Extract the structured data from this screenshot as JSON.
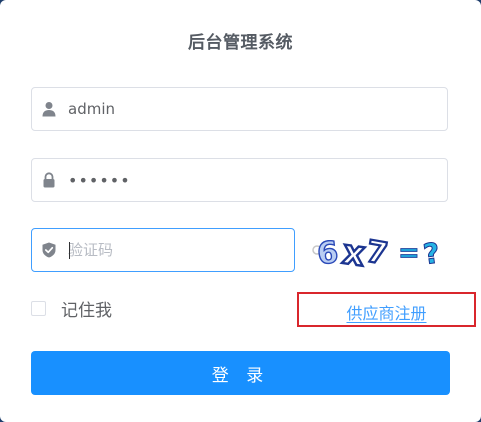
{
  "form": {
    "title": "后台管理系统",
    "username": {
      "value": "admin",
      "icon": "user-icon"
    },
    "password": {
      "value": "••••••",
      "icon": "lock-icon"
    },
    "captcha": {
      "value": "",
      "placeholder": "验证码",
      "icon": "shield-check-icon"
    },
    "captcha_image": {
      "text": "6x7=?"
    },
    "remember": {
      "label": "记住我",
      "checked": false
    },
    "register_link": "供应商注册",
    "login_button": "登 录"
  },
  "colors": {
    "primary": "#1890ff",
    "link": "#409eff",
    "highlight_box": "#d9262c",
    "border": "#dcdfe6",
    "icon": "#7f848c"
  }
}
